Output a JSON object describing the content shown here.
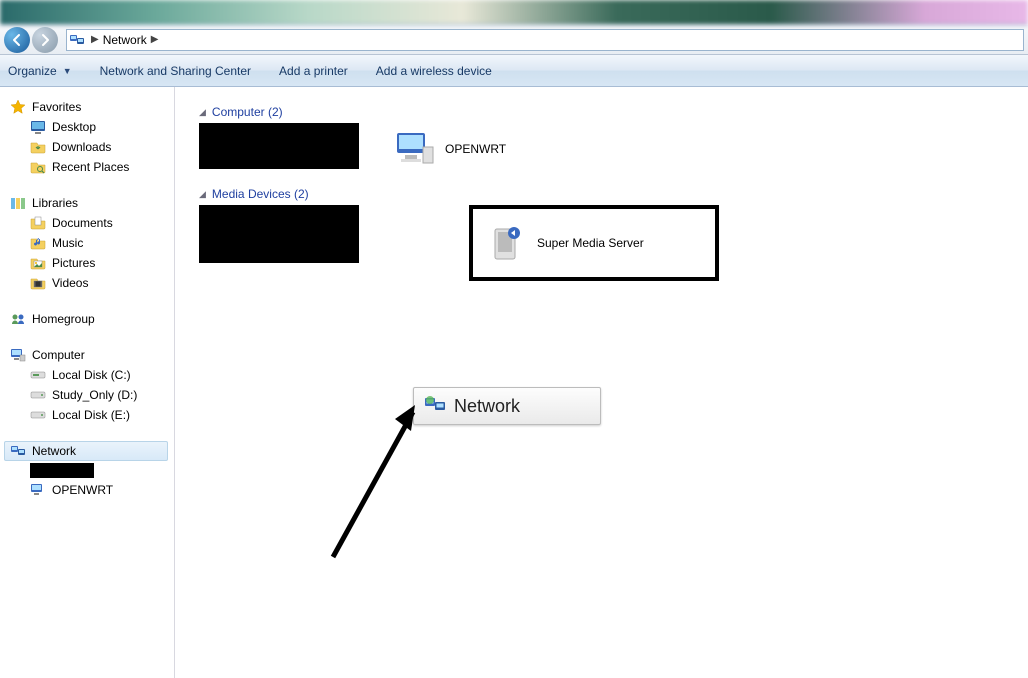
{
  "breadcrumb": {
    "root": "Network"
  },
  "toolbar": {
    "organize": "Organize",
    "network_sharing": "Network and Sharing Center",
    "add_printer": "Add a printer",
    "add_wireless": "Add a wireless device"
  },
  "sidebar": {
    "favorites": {
      "title": "Favorites",
      "desktop": "Desktop",
      "downloads": "Downloads",
      "recent": "Recent Places"
    },
    "libraries": {
      "title": "Libraries",
      "documents": "Documents",
      "music": "Music",
      "pictures": "Pictures",
      "videos": "Videos"
    },
    "homegroup": "Homegroup",
    "computer": {
      "title": "Computer",
      "c": "Local Disk (C:)",
      "d": "Study_Only (D:)",
      "e": "Local Disk (E:)"
    },
    "network": {
      "title": "Network",
      "openwrt": "OPENWRT"
    }
  },
  "content": {
    "computer_section": "Computer (2)",
    "computer_items": {
      "openwrt": "OPENWRT"
    },
    "media_section": "Media Devices (2)",
    "media_items": {
      "sms": "Super Media Server"
    }
  },
  "popup": {
    "network": "Network"
  }
}
